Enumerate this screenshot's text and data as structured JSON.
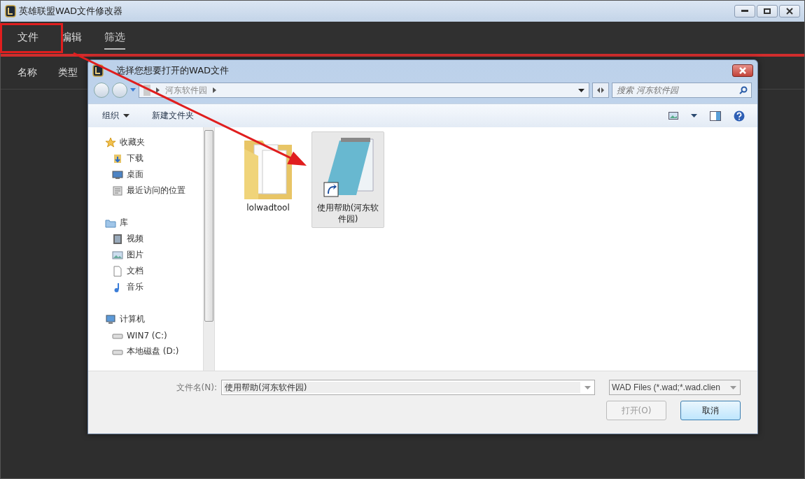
{
  "window": {
    "title": "英雄联盟WAD文件修改器"
  },
  "menu": [
    {
      "label": "文件",
      "selected": false
    },
    {
      "label": "编辑",
      "selected": false
    },
    {
      "label": "筛选",
      "selected": true
    }
  ],
  "columns": [
    "名称",
    "类型"
  ],
  "dialog": {
    "title": "选择您想要打开的WAD文件",
    "breadcrumb": [
      "河东软件园"
    ],
    "search": {
      "placeholder": "搜索 河东软件园"
    },
    "toolbar": [
      {
        "label": "组织",
        "has_menu": true
      },
      {
        "label": "新建文件夹",
        "has_menu": false
      }
    ],
    "nav": [
      {
        "label": "收藏夹",
        "children": [
          {
            "label": "下载"
          },
          {
            "label": "桌面"
          },
          {
            "label": "最近访问的位置"
          }
        ]
      },
      {
        "label": "库",
        "children": [
          {
            "label": "视频"
          },
          {
            "label": "图片"
          },
          {
            "label": "文档"
          },
          {
            "label": "音乐"
          }
        ]
      },
      {
        "label": "计算机",
        "children": [
          {
            "label": "WIN7 (C:)"
          },
          {
            "label": "本地磁盘 (D:)"
          }
        ]
      }
    ],
    "files": [
      {
        "name": "lolwadtool",
        "kind": "folder",
        "selected": false
      },
      {
        "name": "使用帮助(河东软件园)",
        "kind": "shortcut",
        "selected": true
      }
    ],
    "filename_label": "文件名(N):",
    "filename": "使用帮助(河东软件园)",
    "filetype": "WAD Files (*.wad;*.wad.clien",
    "buttons": [
      {
        "label": "打开(O)",
        "disabled": true,
        "default": false
      },
      {
        "label": "取消",
        "disabled": false,
        "default": true
      }
    ]
  }
}
